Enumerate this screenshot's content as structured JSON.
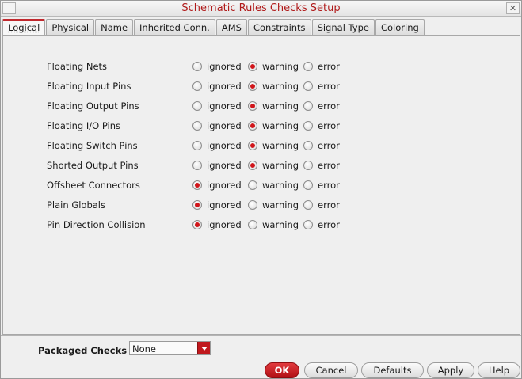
{
  "window": {
    "title": "Schematic Rules Checks Setup"
  },
  "tabs": [
    {
      "label": "Logical",
      "active": true
    },
    {
      "label": "Physical"
    },
    {
      "label": "Name"
    },
    {
      "label": "Inherited Conn."
    },
    {
      "label": "AMS"
    },
    {
      "label": "Constraints"
    },
    {
      "label": "Signal Type"
    },
    {
      "label": "Coloring"
    }
  ],
  "options": [
    "ignored",
    "warning",
    "error"
  ],
  "rules": [
    {
      "label": "Floating Nets",
      "selected": "warning"
    },
    {
      "label": "Floating Input Pins",
      "selected": "warning"
    },
    {
      "label": "Floating Output Pins",
      "selected": "warning"
    },
    {
      "label": "Floating I/O Pins",
      "selected": "warning"
    },
    {
      "label": "Floating Switch Pins",
      "selected": "warning"
    },
    {
      "label": "Shorted Output Pins",
      "selected": "warning"
    },
    {
      "label": "Offsheet Connectors",
      "selected": "ignored"
    },
    {
      "label": "Plain Globals",
      "selected": "ignored"
    },
    {
      "label": "Pin Direction Collision",
      "selected": "ignored"
    }
  ],
  "packaged_checks": {
    "label": "Packaged Checks",
    "value": "None"
  },
  "buttons": {
    "ok": "OK",
    "cancel": "Cancel",
    "defaults": "Defaults",
    "apply": "Apply",
    "help": "Help"
  },
  "colors": {
    "accent": "#c0181d",
    "title": "#b01a1a"
  },
  "icons": {
    "window_menu": "window-menu-icon",
    "close": "close-icon",
    "dropdown": "dropdown-arrow-icon"
  }
}
